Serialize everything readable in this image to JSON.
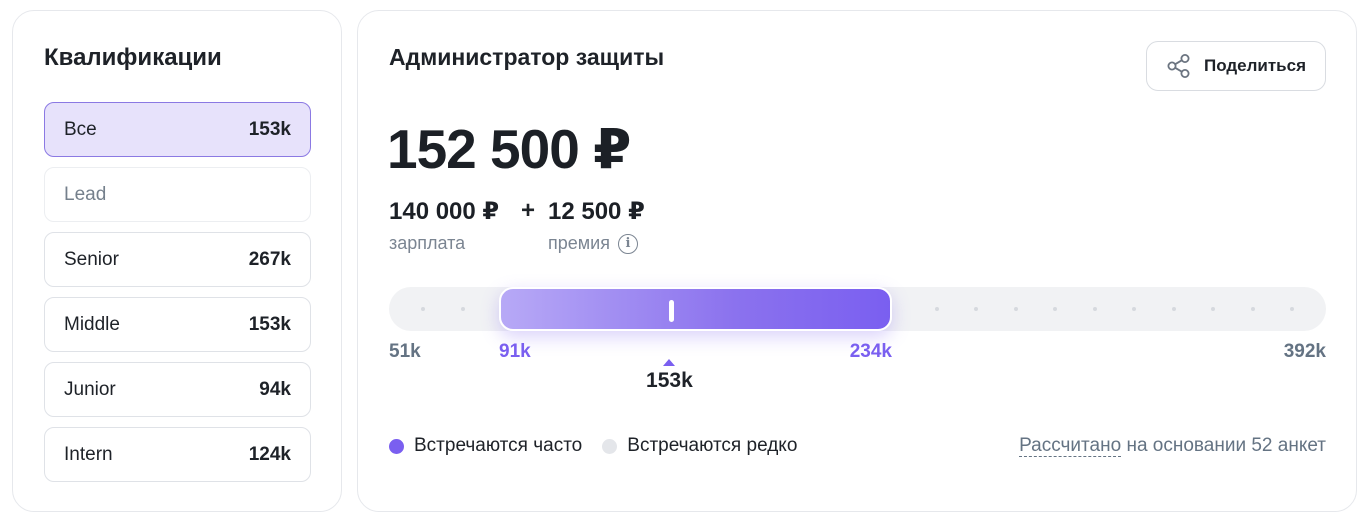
{
  "qualifications": {
    "title": "Квалификации",
    "items": [
      {
        "label": "Все",
        "value": "153k",
        "state": "active"
      },
      {
        "label": "Lead",
        "value": "",
        "state": "disabled"
      },
      {
        "label": "Senior",
        "value": "267k",
        "state": "normal"
      },
      {
        "label": "Middle",
        "value": "153k",
        "state": "normal"
      },
      {
        "label": "Junior",
        "value": "94k",
        "state": "normal"
      },
      {
        "label": "Intern",
        "value": "124k",
        "state": "normal"
      }
    ]
  },
  "job": {
    "title": "Администратор защиты",
    "share_label": "Поделиться",
    "share_icon": "share-icon",
    "total": "152 500 ₽",
    "salary": {
      "amount": "140 000 ₽",
      "label": "зарплата"
    },
    "plus": "+",
    "bonus": {
      "amount": "12 500 ₽",
      "label": "премия",
      "info_icon": "info-icon",
      "info_glyph": "i"
    }
  },
  "range": {
    "min": 51,
    "low": 91,
    "median": 153,
    "high": 234,
    "max": 392,
    "labels": {
      "min": "51k",
      "low": "91k",
      "median": "153k",
      "high": "234k",
      "max": "392k"
    }
  },
  "legend": {
    "frequent": {
      "label": "Встречаются часто",
      "color": "#7a5ff0"
    },
    "rare": {
      "label": "Встречаются редко",
      "color": "#e4e6ea"
    }
  },
  "footnote": {
    "link": "Рассчитано",
    "text": " на основании 52 анкет"
  },
  "colors": {
    "accent": "#7a5ff0",
    "active_bg": "#e7e2fb"
  }
}
